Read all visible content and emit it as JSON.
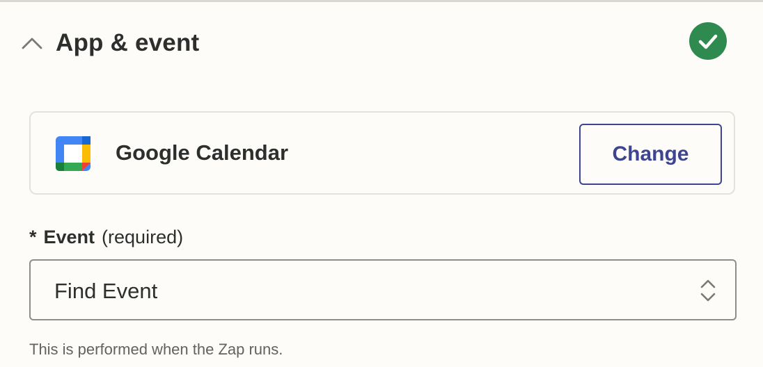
{
  "section": {
    "title": "App & event",
    "collapse_icon": "chevron-up-icon",
    "status_icon": "check-circle-icon",
    "status_color": "#2f8a4f"
  },
  "app": {
    "name": "Google Calendar",
    "logo_icon": "google-calendar-icon",
    "change_label": "Change",
    "change_color": "#3d4592"
  },
  "event": {
    "required_marker": "*",
    "label": "Event",
    "required_text": "(required)",
    "selected_value": "Find Event",
    "select_icon": "chevron-up-down-icon",
    "helper_text": "This is performed when the Zap runs."
  }
}
